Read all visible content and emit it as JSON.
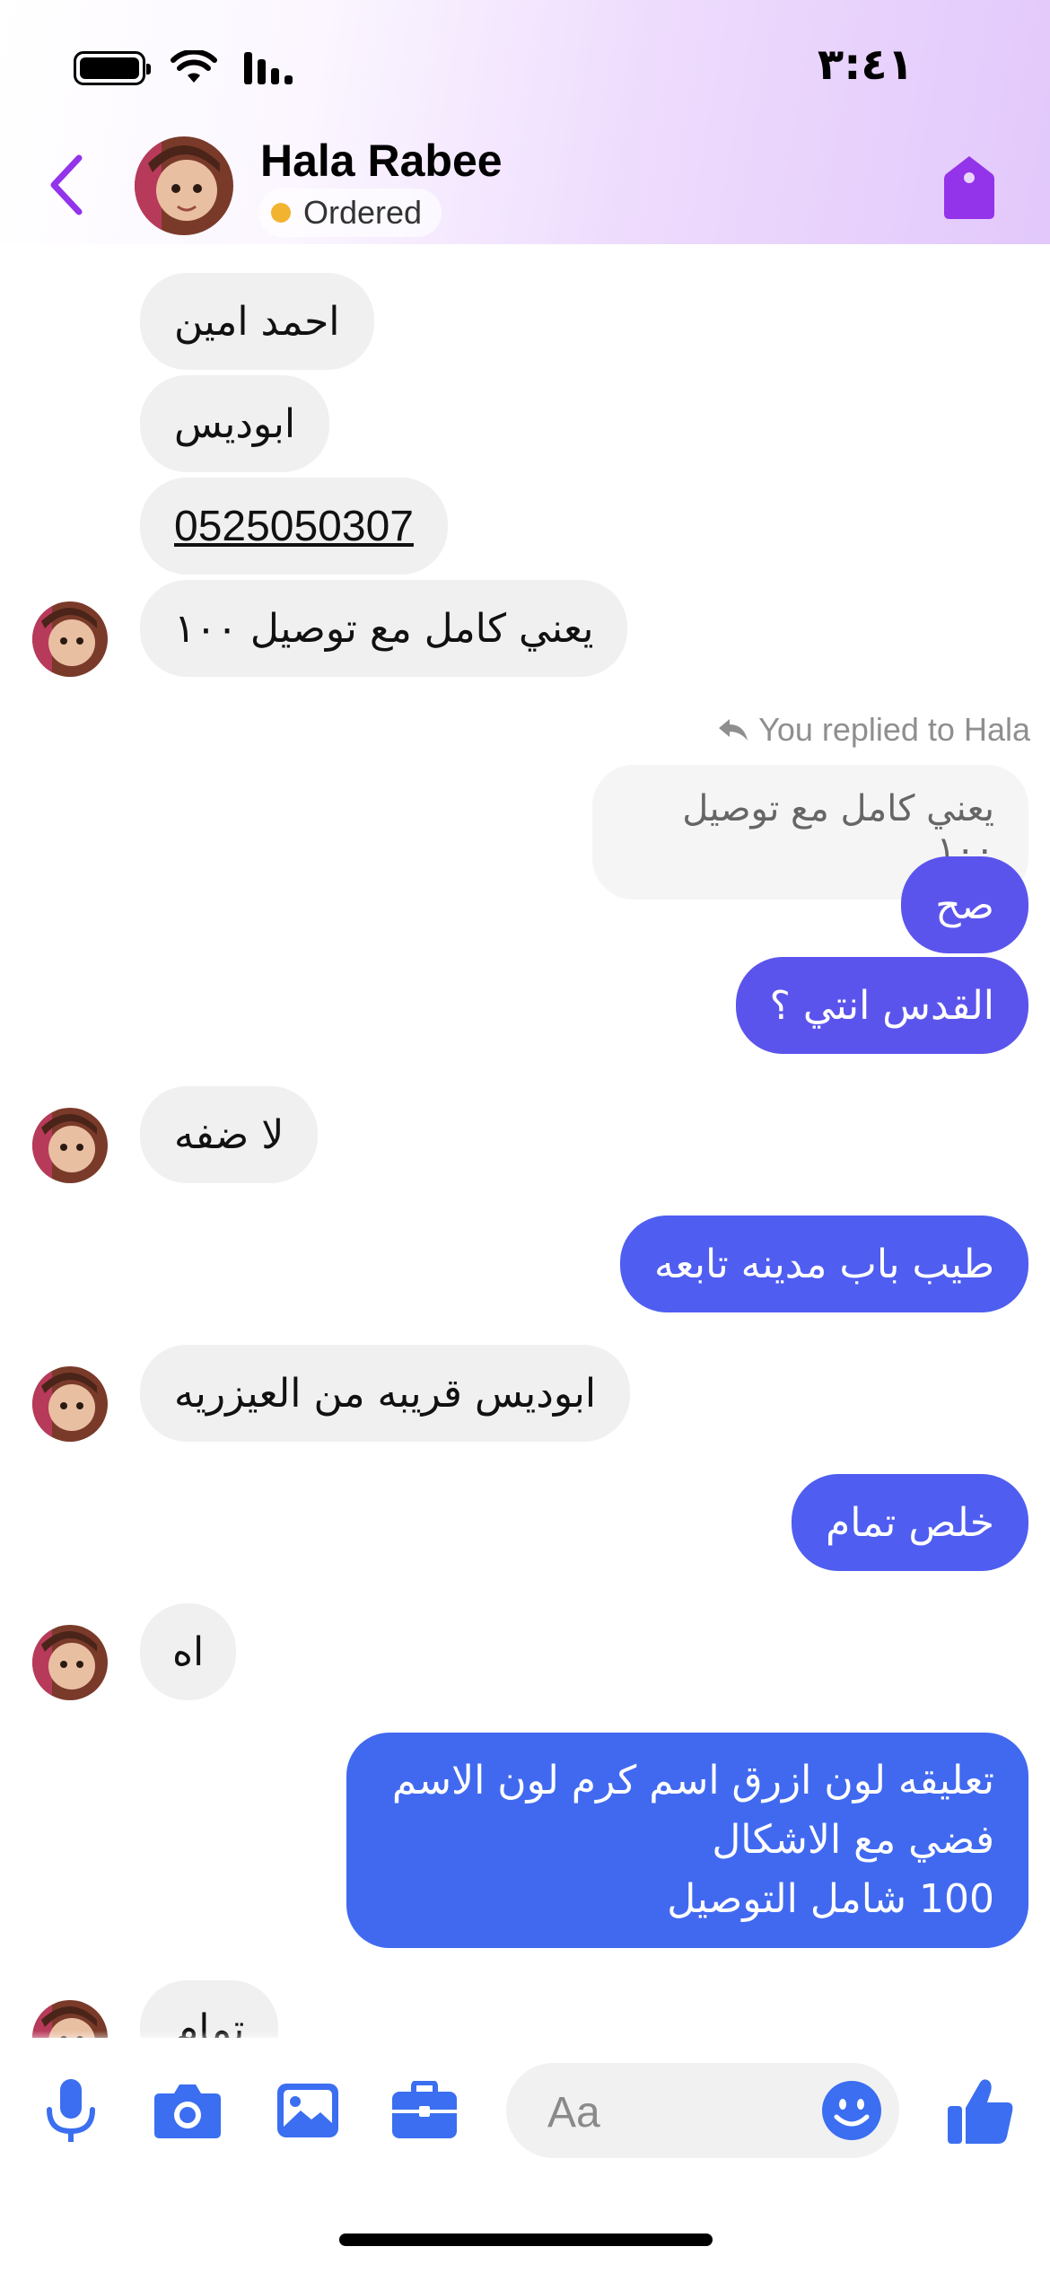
{
  "status_bar": {
    "time": "٣:٤١",
    "icons": [
      "battery-icon",
      "wifi-icon",
      "signal-icon"
    ]
  },
  "header": {
    "back_icon": "chevron-left-icon",
    "contact_name": "Hala Rabee",
    "status_label": "Ordered",
    "status_color": "#f2b430",
    "action_icon": "tag-icon",
    "accent": "#9333ea"
  },
  "messages": {
    "m1": "احمد امين",
    "m2": "ابوديس",
    "m3": "0525050307",
    "m4": "يعني كامل مع توصيل ١٠٠",
    "reply_label": "You replied to Hala",
    "quoted": "يعني كامل مع توصيل ١٠٠",
    "m5": "صح",
    "m6": "القدس انتي ؟",
    "m7": "لا ضفه",
    "m8": "طيب باب مدينه تابعه",
    "m9": "ابوديس قريبه من العيزريه",
    "m10": "خلص تمام",
    "m11": "اه",
    "m12": "تعليقه لون ازرق اسم كرم لون الاسم\nفضي مع الاشكال\n100 شامل التوصيل",
    "m13": "تمام"
  },
  "composer": {
    "placeholder": "Aa",
    "icons": [
      "microphone-icon",
      "camera-icon",
      "gallery-icon",
      "briefcase-icon",
      "emoji-icon",
      "thumbs-up-icon"
    ],
    "icon_color": "#3b6ef0"
  }
}
